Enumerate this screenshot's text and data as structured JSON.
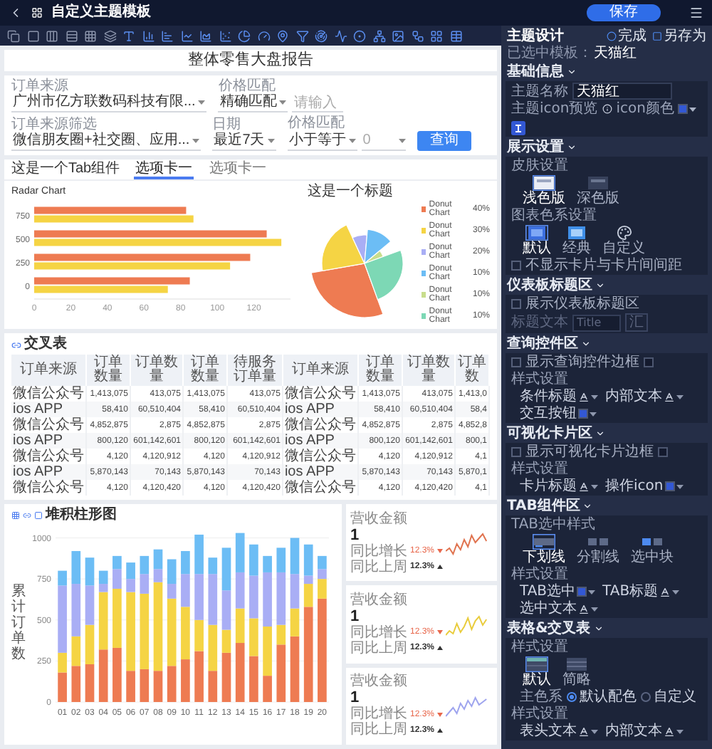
{
  "header": {
    "title": "自定义主题模板",
    "save_button": "保存"
  },
  "report": {
    "title": "整体零售大盘报告",
    "filters": [
      {
        "label": "订单来源",
        "kind": "select",
        "value": "广州市亿方联数码科技有限..."
      },
      {
        "label": "价格匹配",
        "kind": "select_input",
        "value": "精确匹配",
        "placeholder": "请输入"
      },
      {
        "label": "订单来源筛选",
        "kind": "select",
        "value": "微信朋友圈+社交圈、应用..."
      },
      {
        "label": "日期",
        "kind": "select",
        "value": "最近7天"
      },
      {
        "label": "价格匹配",
        "kind": "select_dropdown",
        "value": "小于等于",
        "placeholder": "0"
      }
    ],
    "query_button": "查询",
    "tab_widget": {
      "title": "这是一个Tab组件",
      "tabs": [
        {
          "label": "选项卡一",
          "selected": true
        },
        {
          "label": "选项卡一",
          "selected": false
        }
      ],
      "bar_chart": {
        "title": "Radar Chart",
        "chart_data": {
          "type": "bar",
          "orientation": "horizontal",
          "categories": [
            "750",
            "500",
            "250",
            "0"
          ],
          "xlim": [
            0,
            140
          ],
          "xticks": [
            0,
            20,
            40,
            60,
            80,
            100,
            120
          ],
          "series": [
            {
              "color": "#ee7b52",
              "values": [
                83,
                127,
                118,
                85
              ]
            },
            {
              "color": "#f5d444",
              "values": [
                87,
                135,
                107,
                73
              ]
            }
          ]
        }
      },
      "pie_chart": {
        "title": "这是一个标题",
        "legend": [
          {
            "label": "Donut Chart",
            "percent": "40%",
            "color": "#ee7b52"
          },
          {
            "label": "Donut Chart",
            "percent": "30%",
            "color": "#f5d444"
          },
          {
            "label": "Donut Chart",
            "percent": "20%",
            "color": "#a9aef5"
          },
          {
            "label": "Donut Chart",
            "percent": "10%",
            "color": "#6cbdf5"
          },
          {
            "label": "Donut Chart",
            "percent": "10%",
            "color": "#c8dd8c"
          },
          {
            "label": "Donut Chart",
            "percent": "10%",
            "color": "#7dd8b5"
          }
        ]
      }
    },
    "cross_table": {
      "title": "交叉表",
      "columns": [
        {
          "label": "订单来源",
          "kind": "text"
        },
        {
          "label": "订单数量",
          "kind": "number"
        },
        {
          "label": "订单数量",
          "kind": "number"
        },
        {
          "label": "订单数量",
          "kind": "number"
        },
        {
          "label": "待服务订单量",
          "kind": "number"
        },
        {
          "label": "订单来源",
          "kind": "text"
        },
        {
          "label": "订单数量",
          "kind": "number"
        },
        {
          "label": "订单数量",
          "kind": "number"
        },
        {
          "label": "订单数",
          "kind": "number"
        }
      ],
      "rows": [
        [
          "微信公众号",
          "1,413,075",
          "413,075",
          "1,413,075",
          "413,075",
          "微信公众号",
          "1,413,075",
          "413,075",
          "1,413,0"
        ],
        [
          "ios APP",
          "58,410",
          "60,510,404",
          "58,410",
          "60,510,404",
          "ios APP",
          "58,410",
          "60,510,404",
          "58,4"
        ],
        [
          "微信公众号",
          "4,852,875",
          "2,875",
          "4,852,875",
          "2,875",
          "微信公众号",
          "4,852,875",
          "2,875",
          "4,852,8"
        ],
        [
          "ios APP",
          "800,120",
          "601,142,601",
          "800,120",
          "601,142,601",
          "ios APP",
          "800,120",
          "601,142,601",
          "800,1"
        ],
        [
          "微信公众号",
          "4,120",
          "4,120,912",
          "4,120",
          "4,120,912",
          "微信公众号",
          "4,120",
          "4,120,912",
          "4,1"
        ],
        [
          "ios APP",
          "5,870,143",
          "70,143",
          "5,870,143",
          "70,143",
          "ios APP",
          "5,870,143",
          "70,143",
          "5,870,1"
        ],
        [
          "微信公众号",
          "4,120",
          "4,120,420",
          "4,120",
          "4,120,420",
          "微信公众号",
          "4,120",
          "4,120,420",
          "4,1"
        ]
      ]
    },
    "stacked_chart": {
      "title": "堆积柱形图",
      "chart_data": {
        "type": "bar",
        "stacked": true,
        "grid": true,
        "ylabel": "累计订单数",
        "categories": [
          "01",
          "02",
          "03",
          "04",
          "05",
          "06",
          "07",
          "08",
          "09",
          "10",
          "11",
          "12",
          "13",
          "14",
          "15",
          "16",
          "17",
          "18",
          "19",
          "20"
        ],
        "ylim": [
          0,
          1050
        ],
        "yticks": [
          0,
          250,
          500,
          750,
          1000
        ],
        "series": [
          {
            "color": "#ee7b52",
            "values": [
              180,
              220,
              230,
              320,
              330,
              190,
              200,
              190,
              220,
              260,
              310,
              190,
              300,
              360,
              280,
              160,
              350,
              400,
              580,
              630
            ]
          },
          {
            "color": "#f5d444",
            "values": [
              120,
              180,
              240,
              350,
              360,
              480,
              460,
              540,
              410,
              320,
              190,
              280,
              140,
              210,
              230,
              300,
              120,
              170,
              140,
              120
            ]
          },
          {
            "color": "#a9aef5",
            "values": [
              410,
              320,
              240,
              50,
              120,
              80,
              120,
              80,
              90,
              200,
              280,
              310,
              240,
              220,
              260,
              330,
              320,
              210,
              50,
              60
            ]
          },
          {
            "color": "#6cbdf5",
            "values": [
              90,
              200,
              170,
              80,
              80,
              100,
              110,
              120,
              150,
              140,
              240,
              100,
              260,
              240,
              190,
              100,
              150,
              220,
              190,
              80
            ]
          }
        ]
      }
    },
    "kpi_cards": [
      {
        "label": "营收金额",
        "value": "1",
        "color": "#e0734f",
        "lines": [
          {
            "label": "同比增长",
            "value": "12.3%",
            "up": false
          },
          {
            "label": "同比上周",
            "value": "12.3%",
            "up": true
          }
        ]
      },
      {
        "label": "营收金额",
        "value": "1",
        "color": "#e9cc3c",
        "lines": [
          {
            "label": "同比增长",
            "value": "12.3%",
            "up": false
          },
          {
            "label": "同比上周",
            "value": "12.3%",
            "up": true
          }
        ]
      },
      {
        "label": "营收金额",
        "value": "1",
        "color": "#9ea4ee",
        "lines": [
          {
            "label": "同比增长",
            "value": "12.3%",
            "up": false
          },
          {
            "label": "同比上周",
            "value": "12.3%",
            "up": true
          }
        ]
      }
    ]
  },
  "theme_panel": {
    "title": "主题设计",
    "done_button": "完成",
    "save_as_button": "另存为",
    "selected_template_label": "已选中模板：",
    "selected_template": "天猫红",
    "sections": [
      {
        "title": "基础信息",
        "expanded": true,
        "rows": [
          {
            "kind": "field",
            "label": "主题名称",
            "value": "天猫红"
          },
          {
            "kind": "icon_preview",
            "label": "主题icon预览",
            "color_label": "icon颜色",
            "color": "#3358d4"
          }
        ]
      },
      {
        "title": "展示设置",
        "expanded": true,
        "rows": [
          {
            "kind": "label",
            "text": "皮肤设置"
          },
          {
            "kind": "options",
            "options": [
              {
                "label": "浅色版",
                "kind": "light",
                "selected": true
              },
              {
                "label": "深色版",
                "kind": "dark",
                "selected": false
              }
            ]
          },
          {
            "kind": "label",
            "text": "图表色系设置"
          },
          {
            "kind": "options",
            "options": [
              {
                "label": "默认",
                "kind": "default",
                "selected": true
              },
              {
                "label": "经典",
                "kind": "classic",
                "selected": false
              },
              {
                "label": "自定义",
                "kind": "custom",
                "selected": false
              }
            ]
          },
          {
            "kind": "checkbox",
            "label": "不显示卡片与卡片间间距",
            "checked": false
          }
        ]
      },
      {
        "title": "仪表板标题区",
        "expanded": true,
        "rows": [
          {
            "kind": "checkbox",
            "label": "展示仪表板标题区",
            "checked": false
          },
          {
            "kind": "text_style",
            "label": "标题文本",
            "value": "Title",
            "suffix": "汇",
            "disabled": true
          }
        ]
      },
      {
        "title": "查询控件区",
        "expanded": true,
        "rows": [
          {
            "kind": "checkbox",
            "label": "显示查询控件边框",
            "checked": false,
            "color": "#141a2e"
          },
          {
            "kind": "label",
            "text": "样式设置"
          },
          {
            "kind": "pickers",
            "items": [
              {
                "label": "条件标题",
                "kind": "font"
              },
              {
                "label": "内部文本",
                "kind": "font"
              },
              {
                "label": "交互按钮",
                "kind": "color",
                "color": "#3358d4"
              }
            ]
          }
        ]
      },
      {
        "title": "可视化卡片区",
        "expanded": true,
        "rows": [
          {
            "kind": "checkbox",
            "label": "显示可视化卡片边框",
            "checked": false,
            "color": "#141a2e"
          },
          {
            "kind": "label",
            "text": "样式设置"
          },
          {
            "kind": "pickers",
            "items": [
              {
                "label": "卡片标题",
                "kind": "font"
              },
              {
                "label": "操作icon",
                "kind": "color",
                "color": "#3358d4"
              }
            ]
          }
        ]
      },
      {
        "title": "TAB组件区",
        "expanded": true,
        "rows": [
          {
            "kind": "label",
            "text": "TAB选中样式"
          },
          {
            "kind": "options",
            "options": [
              {
                "label": "下划线",
                "kind": "underline",
                "selected": true
              },
              {
                "label": "分割线",
                "kind": "divider",
                "selected": false
              },
              {
                "label": "选中块",
                "kind": "block",
                "selected": false
              }
            ]
          },
          {
            "kind": "label",
            "text": "样式设置"
          },
          {
            "kind": "pickers",
            "items": [
              {
                "label": "TAB选中",
                "kind": "color",
                "color": "#3358d4"
              },
              {
                "label": "TAB标题",
                "kind": "font"
              },
              {
                "label": "选中文本",
                "kind": "font"
              }
            ]
          }
        ]
      },
      {
        "title": "表格&交叉表",
        "expanded": true,
        "rows": [
          {
            "kind": "label",
            "text": "样式设置"
          },
          {
            "kind": "options",
            "options": [
              {
                "label": "默认",
                "kind": "table_default",
                "selected": true
              },
              {
                "label": "简略",
                "kind": "table_compact",
                "selected": false
              }
            ]
          },
          {
            "kind": "radios",
            "label": "主色系",
            "options": [
              {
                "label": "默认配色",
                "selected": true
              },
              {
                "label": "自定义",
                "selected": false
              }
            ]
          },
          {
            "kind": "label",
            "text": "样式设置"
          },
          {
            "kind": "pickers",
            "items": [
              {
                "label": "表头文本",
                "kind": "font"
              },
              {
                "label": "内部文本",
                "kind": "font"
              }
            ]
          }
        ]
      }
    ]
  }
}
